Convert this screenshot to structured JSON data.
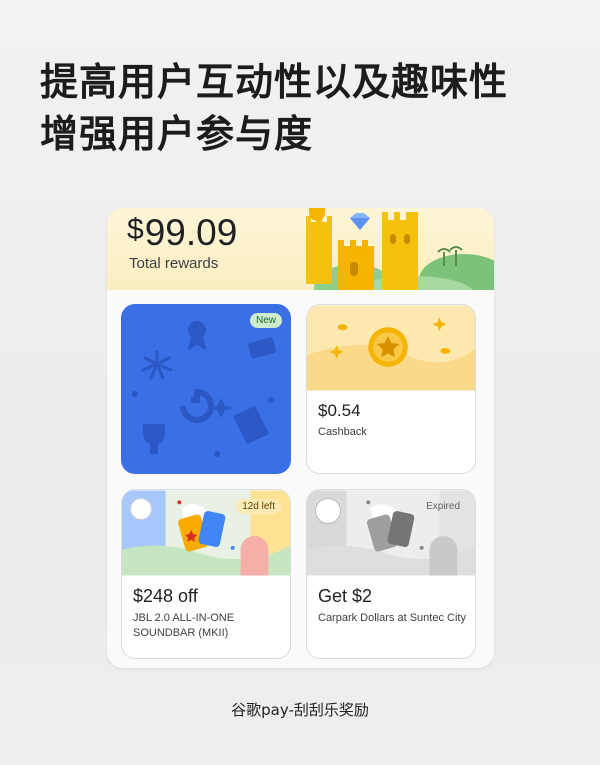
{
  "headline": {
    "line1": "提高用户互动性以及趣味性",
    "line2": "增强用户参与度"
  },
  "rewards": {
    "currency": "$",
    "amount": "99.09",
    "label": "Total rewards"
  },
  "cards": [
    {
      "badge": "New",
      "state": "unscratched"
    },
    {
      "value": "$0.54",
      "description": "Cashback"
    },
    {
      "badge": "12d left",
      "value": "$248 off",
      "description": "JBL 2.0 ALL-IN-ONE SOUNDBAR (MKII)"
    },
    {
      "badge": "Expired",
      "value": "Get $2",
      "description": "Carpark Dollars at Suntec City"
    }
  ],
  "caption": "谷歌pay-刮刮乐奖励",
  "colors": {
    "scratch_blue": "#3a6fe6",
    "hero_yellow": "#fbeec2",
    "new_badge": "#cdeccf",
    "gold": "#f6b400"
  }
}
